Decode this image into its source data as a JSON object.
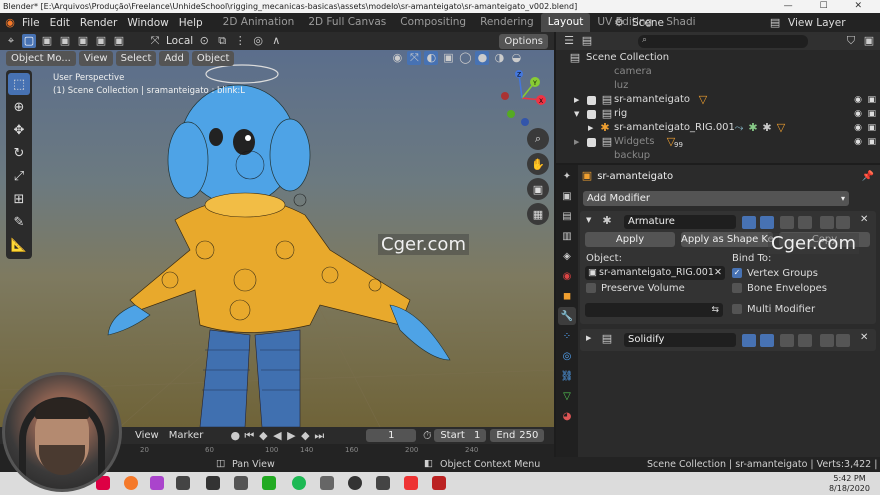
{
  "window": {
    "title": "Blender* [E:\\Arquivos\\Produção\\Freelance\\UnhideSchool\\rigging_mecanicas-basicas\\assets\\modelo\\sr-amanteigato\\sr-amanteigato_v002.blend]",
    "controls": "— ☐ ✕"
  },
  "topbar": {
    "menus": [
      "File",
      "Edit",
      "Render",
      "Window",
      "Help"
    ],
    "workspaces": [
      "2D Animation",
      "2D Full Canvas",
      "Compositing",
      "Rendering",
      "Layout",
      "UV Editing",
      "Shadi"
    ],
    "active_workspace": "Layout",
    "scene": "Scene",
    "view_layer": "View Layer"
  },
  "viewport": {
    "orientation": "Local",
    "options": "Options",
    "mode": "Object Mo...",
    "menus": [
      "View",
      "Select",
      "Add",
      "Object"
    ],
    "info_line1": "User Perspective",
    "info_line2": "(1) Scene Collection | sramanteigato : blink:L",
    "gizmo_labels": [
      "X",
      "Y",
      "Z"
    ],
    "tools": [
      "select-box",
      "cursor",
      "move",
      "rotate",
      "scale",
      "transform",
      "annotate",
      "measure"
    ]
  },
  "timeline": {
    "view": "View",
    "marker": "Marker",
    "current_frame": "1",
    "start_label": "Start",
    "start": "1",
    "end_label": "End",
    "end": "250",
    "ruler_ticks": [
      "20",
      "60",
      "100",
      "140",
      "160",
      "200",
      "240"
    ]
  },
  "outliner": {
    "rows": [
      {
        "label": "Scene Collection",
        "dim": false
      },
      {
        "label": "camera",
        "dim": true
      },
      {
        "label": "luz",
        "dim": true
      },
      {
        "label": "sr-amanteigato",
        "dim": false
      },
      {
        "label": "rig",
        "dim": false
      },
      {
        "label": "sr-amanteigato_RIG.001",
        "dim": false
      },
      {
        "label": "Widgets",
        "dim": true
      },
      {
        "label": "backup",
        "dim": true
      }
    ],
    "widgets_count": "99"
  },
  "properties": {
    "object_name": "sr-amanteigato",
    "add_modifier": "Add Modifier",
    "armature": {
      "name": "Armature",
      "apply": "Apply",
      "apply_shape": "Apply as Shape Key",
      "copy": "Copy",
      "object_label": "Object:",
      "object_value": "sr-amanteigato_RIG.001",
      "preserve_volume": "Preserve Volume",
      "bind_to": "Bind To:",
      "vertex_groups": "Vertex Groups",
      "bone_envelopes": "Bone Envelopes",
      "multi_modifier": "Multi Modifier"
    },
    "solidify": {
      "name": "Solidify"
    }
  },
  "statusbar": {
    "left": "Pan View",
    "middle": "Object Context Menu",
    "right": "Scene Collection | sr-amanteigato | Verts:3,422 | Faces"
  },
  "taskbar": {
    "time": "5:42 PM",
    "date": "8/18/2020"
  },
  "watermarks": [
    "Cger.com",
    "Cger.com"
  ],
  "colors": {
    "accent": "#4772b3",
    "hoodie": "#e8a92c",
    "skin": "#4ea3e6"
  }
}
